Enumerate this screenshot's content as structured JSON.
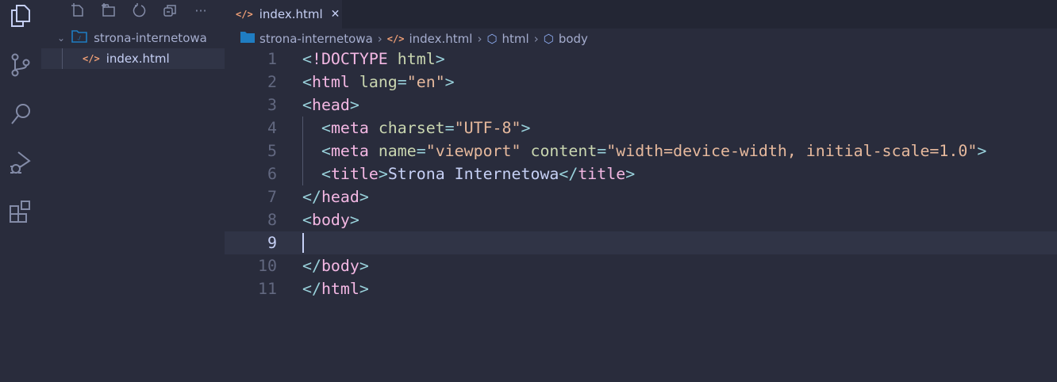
{
  "activity_bar": {
    "items": [
      "explorer",
      "source-control",
      "search",
      "run-debug",
      "extensions"
    ]
  },
  "sidebar": {
    "toolbar": [
      "new-file",
      "new-folder",
      "refresh",
      "collapse-all",
      "more"
    ],
    "more_label": "···",
    "folder": "strona-internetowa",
    "files": [
      "index.html"
    ]
  },
  "tab": {
    "label": "index.html",
    "close": "✕"
  },
  "breadcrumbs": [
    "strona-internetowa",
    "index.html",
    "html",
    "body"
  ],
  "code": {
    "current_line": 9,
    "lines": [
      [
        [
          "p",
          "<"
        ],
        [
          "t",
          "!DOCTYPE"
        ],
        [
          "x",
          " "
        ],
        [
          "a",
          "html"
        ],
        [
          "p",
          ">"
        ]
      ],
      [
        [
          "p",
          "<"
        ],
        [
          "t",
          "html"
        ],
        [
          "x",
          " "
        ],
        [
          "a",
          "lang"
        ],
        [
          "p",
          "="
        ],
        [
          "s",
          "\"en\""
        ],
        [
          "p",
          ">"
        ]
      ],
      [
        [
          "p",
          "<"
        ],
        [
          "t",
          "head"
        ],
        [
          "p",
          ">"
        ]
      ],
      [
        [
          "x",
          "  "
        ],
        [
          "p",
          "<"
        ],
        [
          "t",
          "meta"
        ],
        [
          "x",
          " "
        ],
        [
          "a",
          "charset"
        ],
        [
          "p",
          "="
        ],
        [
          "s",
          "\"UTF-8\""
        ],
        [
          "p",
          ">"
        ]
      ],
      [
        [
          "x",
          "  "
        ],
        [
          "p",
          "<"
        ],
        [
          "t",
          "meta"
        ],
        [
          "x",
          " "
        ],
        [
          "a",
          "name"
        ],
        [
          "p",
          "="
        ],
        [
          "s",
          "\"viewport\""
        ],
        [
          "x",
          " "
        ],
        [
          "a",
          "content"
        ],
        [
          "p",
          "="
        ],
        [
          "s",
          "\"width=device-width, initial-scale=1.0\""
        ],
        [
          "p",
          ">"
        ]
      ],
      [
        [
          "x",
          "  "
        ],
        [
          "p",
          "<"
        ],
        [
          "t",
          "title"
        ],
        [
          "p",
          ">"
        ],
        [
          "x",
          "Strona Internetowa"
        ],
        [
          "p",
          "</"
        ],
        [
          "t",
          "title"
        ],
        [
          "p",
          ">"
        ]
      ],
      [
        [
          "p",
          "</"
        ],
        [
          "t",
          "head"
        ],
        [
          "p",
          ">"
        ]
      ],
      [
        [
          "p",
          "<"
        ],
        [
          "t",
          "body"
        ],
        [
          "p",
          ">"
        ]
      ],
      [],
      [
        [
          "p",
          "</"
        ],
        [
          "t",
          "body"
        ],
        [
          "p",
          ">"
        ]
      ],
      [
        [
          "p",
          "</"
        ],
        [
          "t",
          "html"
        ],
        [
          "p",
          ">"
        ]
      ]
    ]
  }
}
